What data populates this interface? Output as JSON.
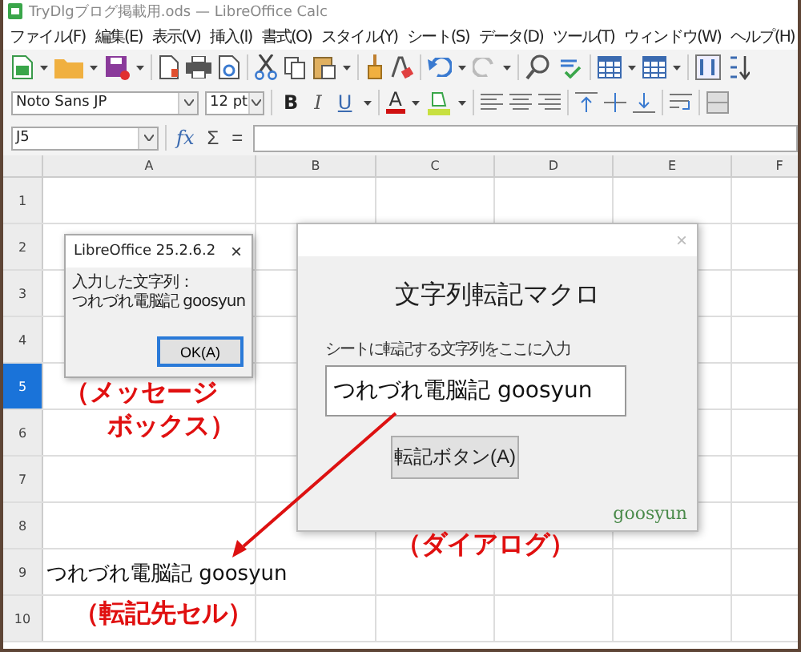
{
  "window": {
    "title": "TryDlgブログ掲載用.ods — LibreOffice Calc"
  },
  "menu": [
    "ファイル(F)",
    "編集(E)",
    "表示(V)",
    "挿入(I)",
    "書式(O)",
    "スタイル(Y)",
    "シート(S)",
    "データ(D)",
    "ツール(T)",
    "ウィンドウ(W)",
    "ヘルプ(H)"
  ],
  "format_toolbar": {
    "font_name": "Noto Sans JP",
    "font_size": "12 pt",
    "style_buttons": [
      "B",
      "I",
      "U"
    ],
    "font_color_label": "A"
  },
  "formula_bar": {
    "name_box": "J5",
    "buttons": [
      "fx",
      "Σ",
      "="
    ]
  },
  "columns": [
    "A",
    "B",
    "C",
    "D",
    "E",
    "F"
  ],
  "rows": [
    {
      "label": "1",
      "selected": false,
      "cells": []
    },
    {
      "label": "2",
      "selected": false,
      "cells": []
    },
    {
      "label": "3",
      "selected": false,
      "cells": []
    },
    {
      "label": "4",
      "selected": false,
      "cells": []
    },
    {
      "label": "5",
      "selected": true,
      "cells": []
    },
    {
      "label": "6",
      "selected": false,
      "cells": []
    },
    {
      "label": "7",
      "selected": false,
      "cells": []
    },
    {
      "label": "8",
      "selected": false,
      "cells": []
    },
    {
      "label": "9",
      "selected": false,
      "cells": [
        "つれづれ電脳記 goosyun"
      ]
    },
    {
      "label": "10",
      "selected": false,
      "cells": []
    }
  ],
  "message_box": {
    "title": "LibreOffice 25.2.6.2",
    "close": "×",
    "lines": [
      "入力した文字列：",
      "つれづれ電脳記 goosyun"
    ],
    "button": "OK(A)"
  },
  "dialog": {
    "close": "×",
    "title": "文字列転記マクロ",
    "field_label": "シートに転記する文字列をここに入力",
    "field_value": "つれづれ電脳記 goosyun",
    "button": "転記ボタン(A)",
    "brand": "goosyun"
  },
  "annotations": [
    {
      "lines": [
        "（メッセージ",
        "ボックス）"
      ]
    },
    {
      "lines": [
        "（ダイアログ）"
      ]
    },
    {
      "lines": [
        "（転記先セル）"
      ]
    }
  ]
}
